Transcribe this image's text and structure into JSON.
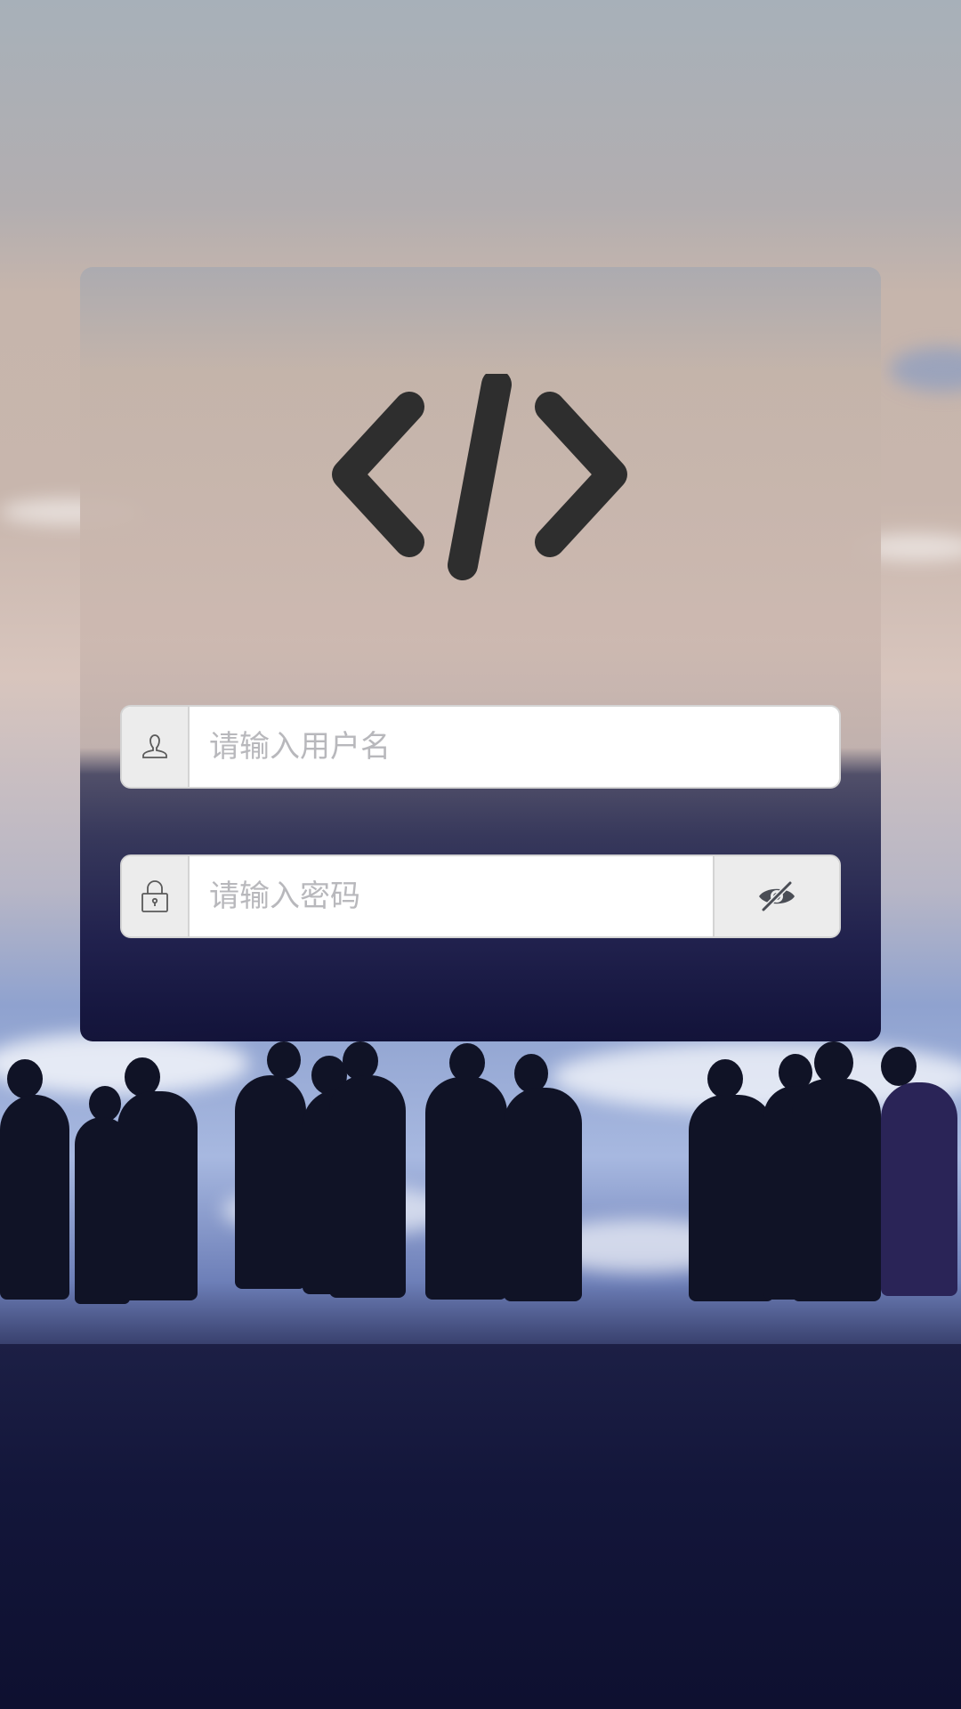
{
  "logo": {
    "icon": "code-brackets-icon"
  },
  "login_form": {
    "username": {
      "placeholder": "请输入用户名",
      "value": "",
      "icon": "user-icon"
    },
    "password": {
      "placeholder": "请输入密码",
      "value": "",
      "icon": "lock-icon",
      "toggle_icon": "eye-off-icon"
    }
  },
  "colors": {
    "logo": "#2e2e2e",
    "field_addon_bg": "#ececec",
    "placeholder": "#b8b8bc"
  }
}
